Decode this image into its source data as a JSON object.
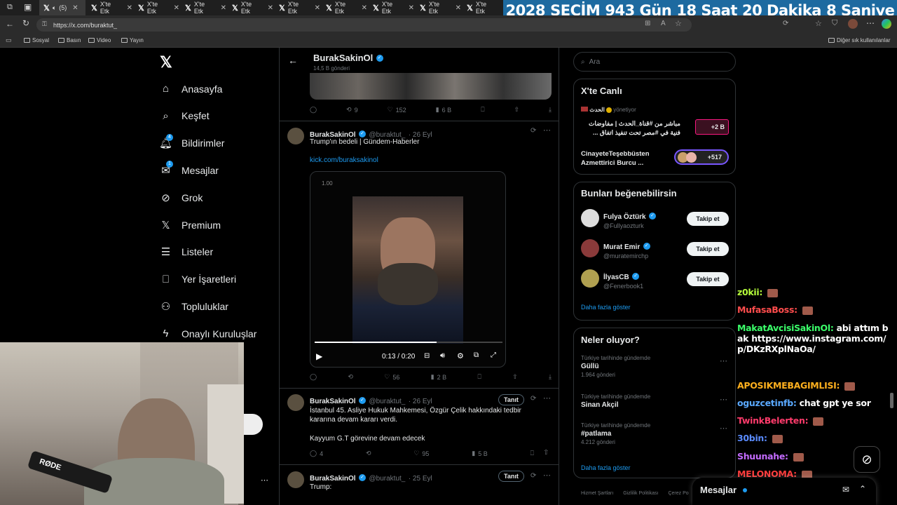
{
  "browser": {
    "tab_notice": "(5)",
    "tabs": [
      "X'te Etk",
      "X'te Etk",
      "X'te Etk",
      "X'te Etk",
      "X'te Etk",
      "X'te Etk",
      "X'te Etk",
      "X'te Etk",
      "X'te Etk"
    ],
    "url": "https://x.com/buraktut_",
    "bookmarks": [
      "Sosyal",
      "Basın",
      "Video",
      "Yayın"
    ],
    "other_bookmarks": "Diğer sık kullanılanlar"
  },
  "countdown": {
    "year": "2028",
    "label": "SEÇİM",
    "days": "943 Gün",
    "hours": "18 Saat",
    "minutes": "20 Dakika",
    "seconds": "8 Saniye"
  },
  "sidebar": {
    "items": [
      {
        "label": "Anasayfa",
        "icon": "home-icon"
      },
      {
        "label": "Keşfet",
        "icon": "search-icon"
      },
      {
        "label": "Bildirimler",
        "icon": "bell-icon",
        "badge": "4"
      },
      {
        "label": "Mesajlar",
        "icon": "mail-icon",
        "badge": "1"
      },
      {
        "label": "Grok",
        "icon": "grok-icon"
      },
      {
        "label": "Premium",
        "icon": "x-logo-icon"
      },
      {
        "label": "Listeler",
        "icon": "list-icon"
      },
      {
        "label": "Yer İşaretleri",
        "icon": "bookmark-icon"
      },
      {
        "label": "Topluluklar",
        "icon": "communities-icon"
      },
      {
        "label": "Onaylı Kuruluşlar",
        "icon": "lightning-icon"
      }
    ]
  },
  "profile_header": {
    "name": "BurakSakinOl",
    "posts": "14,5 B gönderi"
  },
  "tweets": [
    {
      "actions": {
        "replies": "",
        "retweets": "9",
        "likes": "152",
        "views": "6 B"
      }
    },
    {
      "name": "BurakSakinOl",
      "handle": "@buraktut_",
      "date": "· 26 Eyl",
      "text": "Trump'ın bedeli | Gündem-Haberler",
      "link": "kick.com/buraksakinol",
      "video": {
        "speed": "1.00",
        "time": "0:13 / 0:20",
        "progress": 0.65
      },
      "actions": {
        "replies": "",
        "retweets": "",
        "likes": "56",
        "views": "2 B"
      }
    },
    {
      "name": "BurakSakinOl",
      "handle": "@buraktut_",
      "date": "· 26 Eyl",
      "promo": "Tanıt",
      "text": "İstanbul 45. Asliye Hukuk Mahkemesi, Özgür Çelik hakkındaki tedbir kararına devam kararı verdi.",
      "text2": "Kayyum G.T görevine devam edecek",
      "actions": {
        "replies": "4",
        "retweets": "",
        "likes": "95",
        "views": "5 B"
      }
    },
    {
      "name": "BurakSakinOl",
      "handle": "@buraktut_",
      "date": "· 25 Eyl",
      "promo": "Tanıt",
      "text": "Trump:"
    }
  ],
  "search": {
    "placeholder": "Ara"
  },
  "live": {
    "title": "X'te Canlı",
    "items": [
      {
        "host": "الحدث",
        "host_suffix": "yönetiyor",
        "text": "مباشر من #قناة_الحدث | مفاوضات فنية في #مصر تحت تنفيذ اتفاق ...",
        "count": "+2 B"
      },
      {
        "text": "CinayeteTeşebbüsten Azmettirici Burcu ...",
        "count": "+517"
      }
    ]
  },
  "who_to_follow": {
    "title": "Bunları beğenebilirsin",
    "users": [
      {
        "name": "Fulya Öztürk",
        "handle": "@Fullyaozturk",
        "button": "Takip et"
      },
      {
        "name": "Murat Emir",
        "handle": "@muratemirchp",
        "button": "Takip et"
      },
      {
        "name": "İlyasCB",
        "handle": "@Fenerbook1",
        "button": "Takip et"
      }
    ],
    "more": "Daha fazla göster"
  },
  "trends": {
    "title": "Neler oluyor?",
    "items": [
      {
        "context": "Türkiye tarihinde gündemde",
        "name": "Güllü",
        "count": "1.964 gönderi"
      },
      {
        "context": "Türkiye tarihinde gündemde",
        "name": "Sinan Akçil",
        "count": ""
      },
      {
        "context": "Türkiye tarihinde gündemde",
        "name": "#patlama",
        "count": "4.212 gönderi"
      }
    ],
    "more": "Daha fazla göster"
  },
  "footer_links": [
    "Hizmet Şartları",
    "Gizlilik Politikası",
    "Çerez Po"
  ],
  "messages_bar": {
    "label": "Mesajlar"
  },
  "chat": [
    {
      "user": "z0kii:",
      "color": "#b6ff3b",
      "msg": ""
    },
    {
      "user": "MufasaBoss:",
      "color": "#ff4d4d",
      "msg": ""
    },
    {
      "user": "MakatAvcisiSakinOl:",
      "color": "#3bff6a",
      "msg": "abi attım bak https://www.instagram.com/p/DKzRXplNaOa/"
    },
    {
      "user": "APOSIKMEBAGIMLISI:",
      "color": "#ffb01e",
      "msg": ""
    },
    {
      "user": "oguzcetinfb:",
      "color": "#5aa9ff",
      "msg": "chat gpt ye sor"
    },
    {
      "user": "TwinkBelerten:",
      "color": "#ff3b6b",
      "msg": ""
    },
    {
      "user": "30bin:",
      "color": "#5a8bff",
      "msg": ""
    },
    {
      "user": "Shuunahe:",
      "color": "#c46bff",
      "msg": ""
    },
    {
      "user": "MELONOMA:",
      "color": "#ff3b3b",
      "msg": ""
    }
  ],
  "colors": {
    "accent": "#1d9bf0",
    "countdown_bg": "#1d6aa0",
    "background": "#000000"
  }
}
